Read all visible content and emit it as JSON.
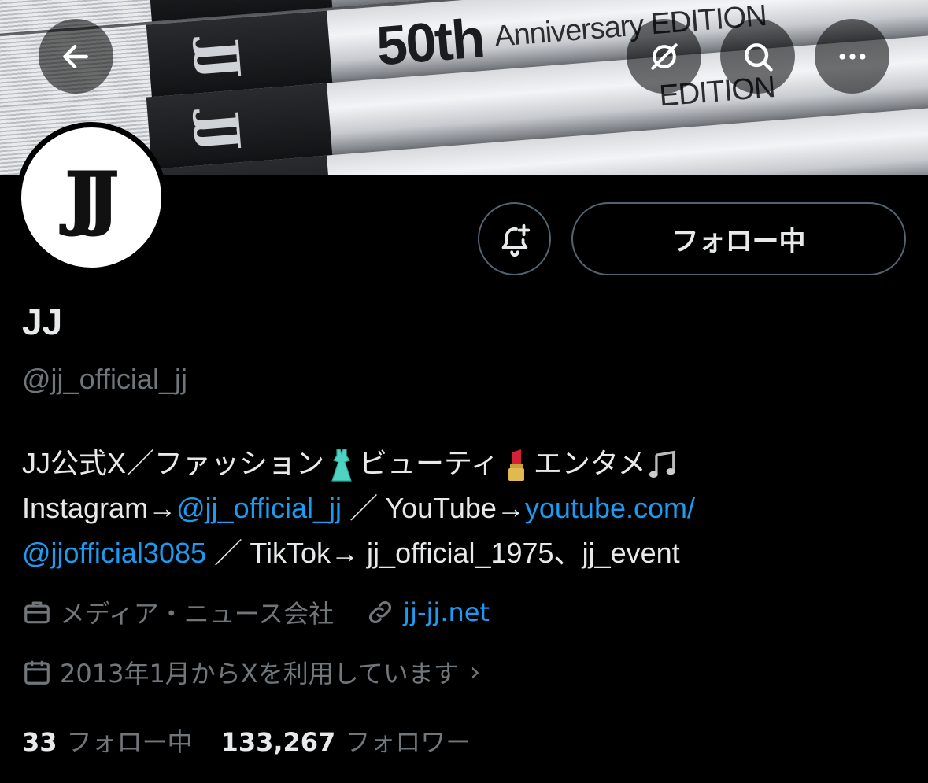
{
  "banner": {
    "book_spine_text": "JJ",
    "book_number": "50th",
    "book_edition": "Anniversary EDITION",
    "book_edition_partial": "EDITION"
  },
  "header_buttons": {
    "back_icon": "arrow-left-icon",
    "translate_icon": "translate-icon",
    "search_icon": "search-icon",
    "more_icon": "more-horizontal-icon"
  },
  "profile": {
    "avatar_text": "JJ",
    "name": "JJ",
    "handle": "@jj_official_jj",
    "follow_button_label": "フォロー中",
    "notify_icon": "bell-plus-icon"
  },
  "bio": {
    "line1": {
      "part1": "JJ公式X／ファッション",
      "emoji1": "dress-emoji",
      "part2": "ビューティ",
      "emoji2": "lipstick-emoji",
      "part3": "エンタメ",
      "emoji3": "musical-notes-emoji"
    },
    "line2": {
      "part1": "Instagram→",
      "link1": "@jj_official_jj",
      "part2": " ／ YouTube→",
      "link2": "youtube.com/"
    },
    "line3": {
      "link1": "@jjofficial3085",
      "part1": " ／ TikTok→ jj_official_1975、jj_event"
    }
  },
  "meta": {
    "category": "メディア・ニュース会社",
    "website": "jj-jj.net",
    "joined": "2013年1月からXを利用しています",
    "chevron": "›"
  },
  "stats": {
    "following_count": "33",
    "following_label": "フォロー中",
    "followers_count": "133,267",
    "followers_label": "フォロワー"
  },
  "colors": {
    "background": "#000000",
    "text": "#e7e9ea",
    "secondary": "#71767b",
    "link": "#1d9bf0",
    "border": "#536471"
  }
}
